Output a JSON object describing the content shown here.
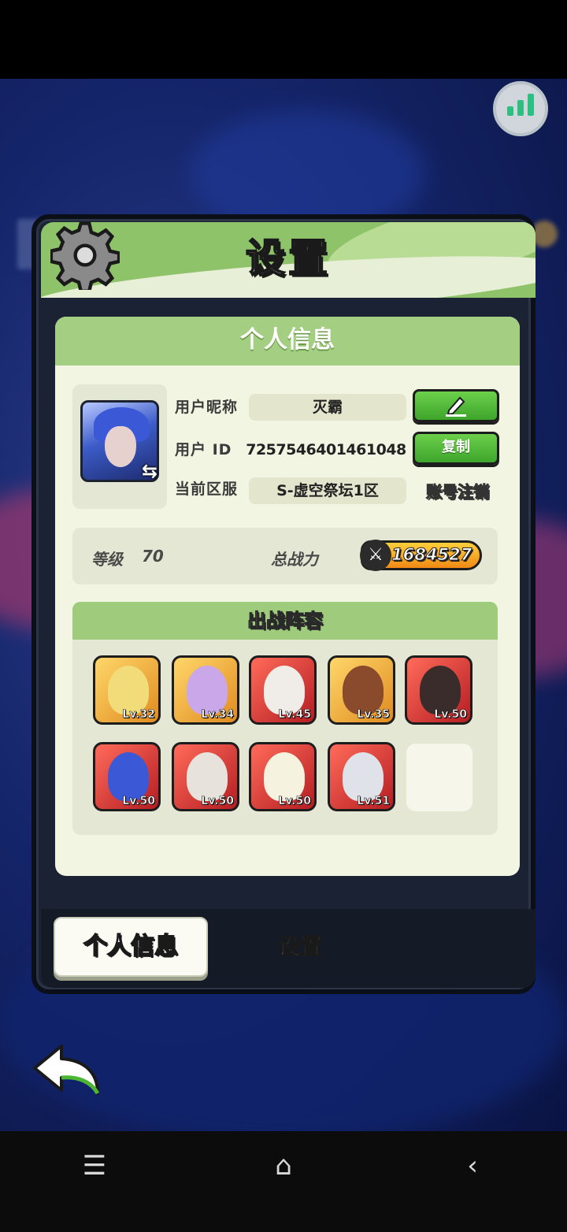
{
  "header": {
    "title": "设置"
  },
  "profile": {
    "section_title": "个人信息",
    "nickname_label": "用户昵称",
    "nickname": "灭霸",
    "id_label": "用户 ID",
    "user_id": "7257546401461048",
    "copy_label": "复制",
    "server_label": "当前区服",
    "server": "S-虚空祭坛1区",
    "logout_label": "账号注销"
  },
  "stats": {
    "level_label": "等级",
    "level": "70",
    "power_label": "总战力",
    "power": "1684527"
  },
  "team": {
    "title": "出战阵容",
    "heroes": [
      {
        "level": "Lv.32",
        "frame": "gold"
      },
      {
        "level": "Lv.34",
        "frame": "gold"
      },
      {
        "level": "Lv.45",
        "frame": "red"
      },
      {
        "level": "Lv.35",
        "frame": "gold"
      },
      {
        "level": "Lv.50",
        "frame": "red"
      },
      {
        "level": "Lv.50",
        "frame": "red"
      },
      {
        "level": "Lv.50",
        "frame": "red"
      },
      {
        "level": "Lv.50",
        "frame": "red"
      },
      {
        "level": "Lv.51",
        "frame": "red"
      }
    ]
  },
  "tabs": {
    "active": "个人信息",
    "other": "设置"
  },
  "icons": {
    "gear": "gear-icon",
    "edit": "pencil-icon",
    "swap": "swap-icon",
    "power": "crossed-swords-icon",
    "back": "back-arrow-icon",
    "menu": "menu-icon",
    "home": "home-icon",
    "nav_back": "chevron-left-icon",
    "signal": "signal-bars-icon"
  },
  "colors": {
    "accent_green": "#8fc36a",
    "button_green": "#4bb534",
    "panel_bg": "#f3f5e3"
  }
}
